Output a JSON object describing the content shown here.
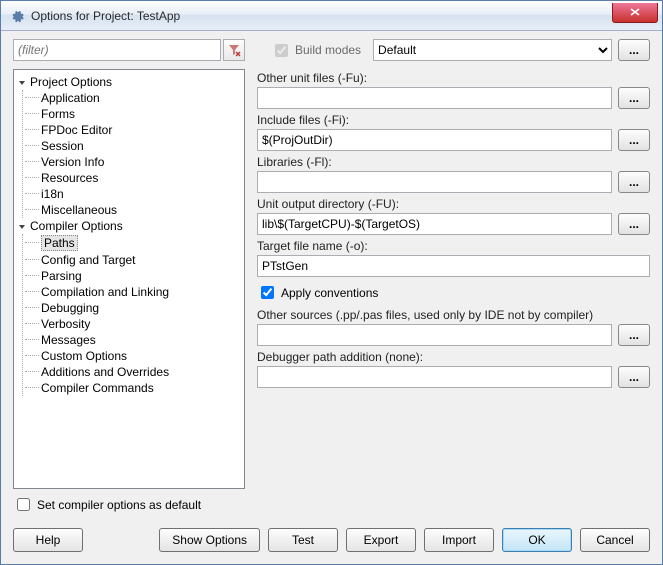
{
  "title": "Options for Project: TestApp",
  "filter": {
    "placeholder": "(filter)"
  },
  "build_modes": {
    "label": "Build modes",
    "checked": true,
    "selected": "Default",
    "options": [
      "Default"
    ]
  },
  "tree": {
    "project_options": {
      "label": "Project Options",
      "items": [
        "Application",
        "Forms",
        "FPDoc Editor",
        "Session",
        "Version Info",
        "Resources",
        "i18n",
        "Miscellaneous"
      ]
    },
    "compiler_options": {
      "label": "Compiler Options",
      "items": [
        "Paths",
        "Config and Target",
        "Parsing",
        "Compilation and Linking",
        "Debugging",
        "Verbosity",
        "Messages",
        "Custom Options",
        "Additions and Overrides",
        "Compiler Commands"
      ],
      "selected_index": 0
    }
  },
  "fields": {
    "other_unit": {
      "label": "Other unit files (-Fu):",
      "value": ""
    },
    "include": {
      "label": "Include files (-Fi):",
      "value": "$(ProjOutDir)"
    },
    "libraries": {
      "label": "Libraries (-Fl):",
      "value": ""
    },
    "unit_output": {
      "label": "Unit output directory (-FU):",
      "value": "lib\\$(TargetCPU)-$(TargetOS)"
    },
    "target_file": {
      "label": "Target file name (-o):",
      "value": "PTstGen"
    },
    "apply_conventions": {
      "label": "Apply conventions",
      "checked": true
    },
    "other_sources": {
      "label": "Other sources (.pp/.pas files, used only by IDE not by compiler)",
      "value": ""
    },
    "debugger_path": {
      "label": "Debugger path addition (none):",
      "value": ""
    }
  },
  "footer": {
    "set_default": "Set compiler options as default"
  },
  "buttons": {
    "help": "Help",
    "show_options": "Show Options",
    "test": "Test",
    "export": "Export",
    "import": "Import",
    "ok": "OK",
    "cancel": "Cancel"
  },
  "ellipsis": "..."
}
